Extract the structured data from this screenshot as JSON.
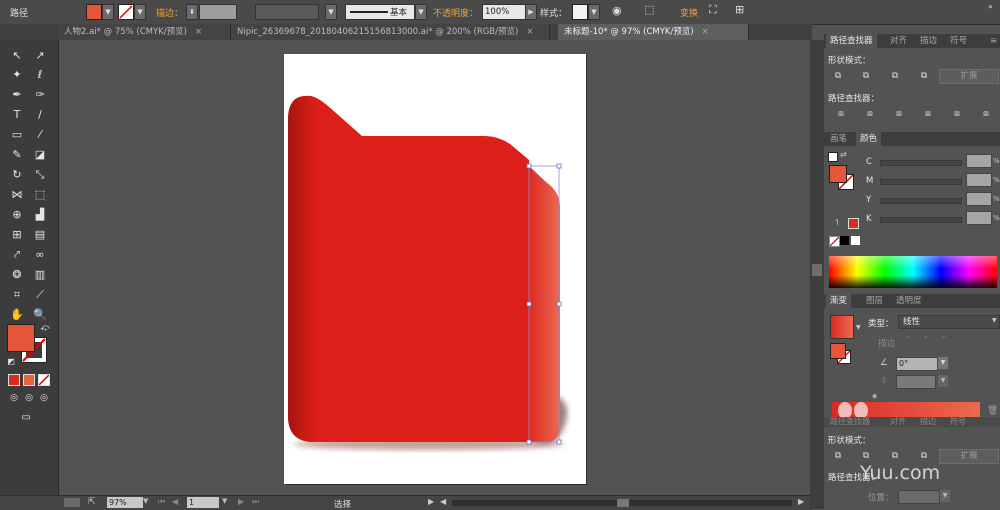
{
  "control_bar": {
    "title": "路径",
    "stroke_label": "描边：",
    "stroke_style": "基本",
    "opacity_label": "不透明度：",
    "opacity_value": "100%",
    "style_label": "样式：",
    "transform_label": "变换",
    "fill_color": "#e5553a"
  },
  "tabs": [
    {
      "label": "人物2.ai* @ 75% (CMYK/预览)",
      "close": "×"
    },
    {
      "label": "Nipic_26369678_20180406215156813000.ai* @ 200% (RGB/预览)",
      "close": "×"
    },
    {
      "label": "未标题-10* @ 97% (CMYK/预览)",
      "close": "×"
    }
  ],
  "status_bar": {
    "zoom": "97%",
    "artboard": "1",
    "mode": "选择"
  },
  "pathfinder_panel": {
    "tabs": [
      "路径查找器",
      "对齐",
      "描边",
      "符号"
    ],
    "shape_modes_label": "形状模式：",
    "pathfinder_label": "路径查找器：",
    "expand_label": "扩展"
  },
  "color_panel": {
    "tabs": [
      "画笔",
      "颜色"
    ],
    "channels": [
      "C",
      "M",
      "Y",
      "K"
    ],
    "pct": "%"
  },
  "gradient_panel": {
    "tabs": [
      "渐变",
      "图层",
      "透明度"
    ],
    "type_label": "类型：",
    "type_value": "线性",
    "stroke_label": "描边",
    "angle_value": "0°",
    "start_color": "#dc2a22",
    "end_color": "#ec6a50"
  },
  "pathfinder_panel_2": {
    "tabs": [
      "路径查找器",
      "对齐",
      "描边",
      "符号"
    ],
    "shape_modes_label": "形状模式：",
    "expand_label": "扩展",
    "pathfinder_label": "路径查找器：",
    "position_label": "位置："
  },
  "watermark": "Yuu.com",
  "colors": {
    "folder_red": "#dc1f18",
    "folder_dark": "#b21411",
    "accent_orange": "#f0a040"
  }
}
